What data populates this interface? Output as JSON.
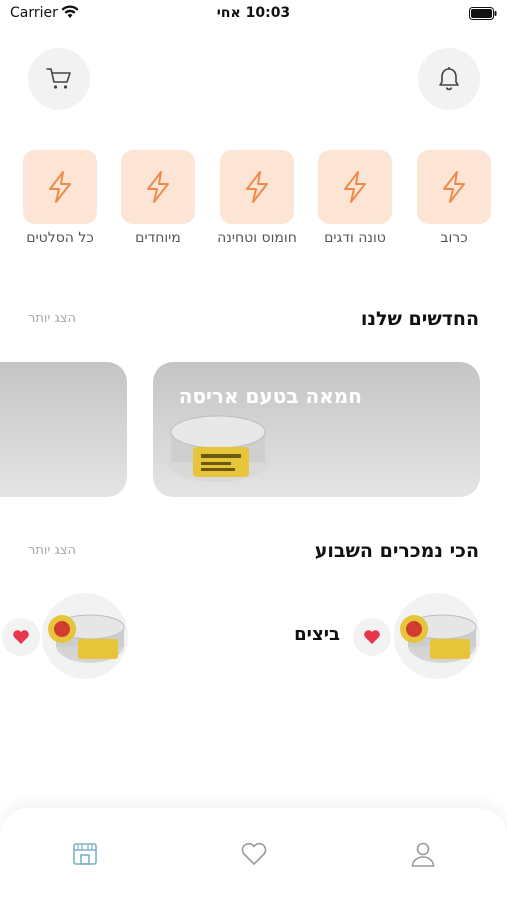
{
  "status_bar": {
    "carrier": "Carrier",
    "time": "10:03 אחי"
  },
  "header": {
    "cart_icon": "cart-icon",
    "bell_icon": "bell-icon"
  },
  "categories": [
    {
      "label": "כרוב",
      "icon": "bolt-icon"
    },
    {
      "label": "טונה ודגים",
      "icon": "bolt-icon"
    },
    {
      "label": "חומוס וטחינה",
      "icon": "bolt-icon"
    },
    {
      "label": "מיוחדים",
      "icon": "bolt-icon"
    },
    {
      "label": "כל הסלטים",
      "icon": "bolt-icon"
    }
  ],
  "new_section": {
    "title": "החדשים שלנו",
    "show_more": "הצג יותר",
    "cards": [
      {
        "title": "חמאה בטעם אריסה"
      }
    ]
  },
  "best_sellers": {
    "title": "הכי נמכרים השבוע",
    "show_more": "הצג יותר",
    "items": [
      {
        "name": "ביצים"
      },
      {
        "name": ""
      }
    ]
  },
  "tab_bar": {
    "tabs": [
      "store-icon",
      "heart-outline-icon",
      "user-icon"
    ]
  },
  "colors": {
    "accent": "#f08a4b",
    "tile_bg": "#fde5d6",
    "heart": "#e8374a",
    "tab_active": "#7fb0c8",
    "tab_inactive": "#9a9a9a"
  }
}
